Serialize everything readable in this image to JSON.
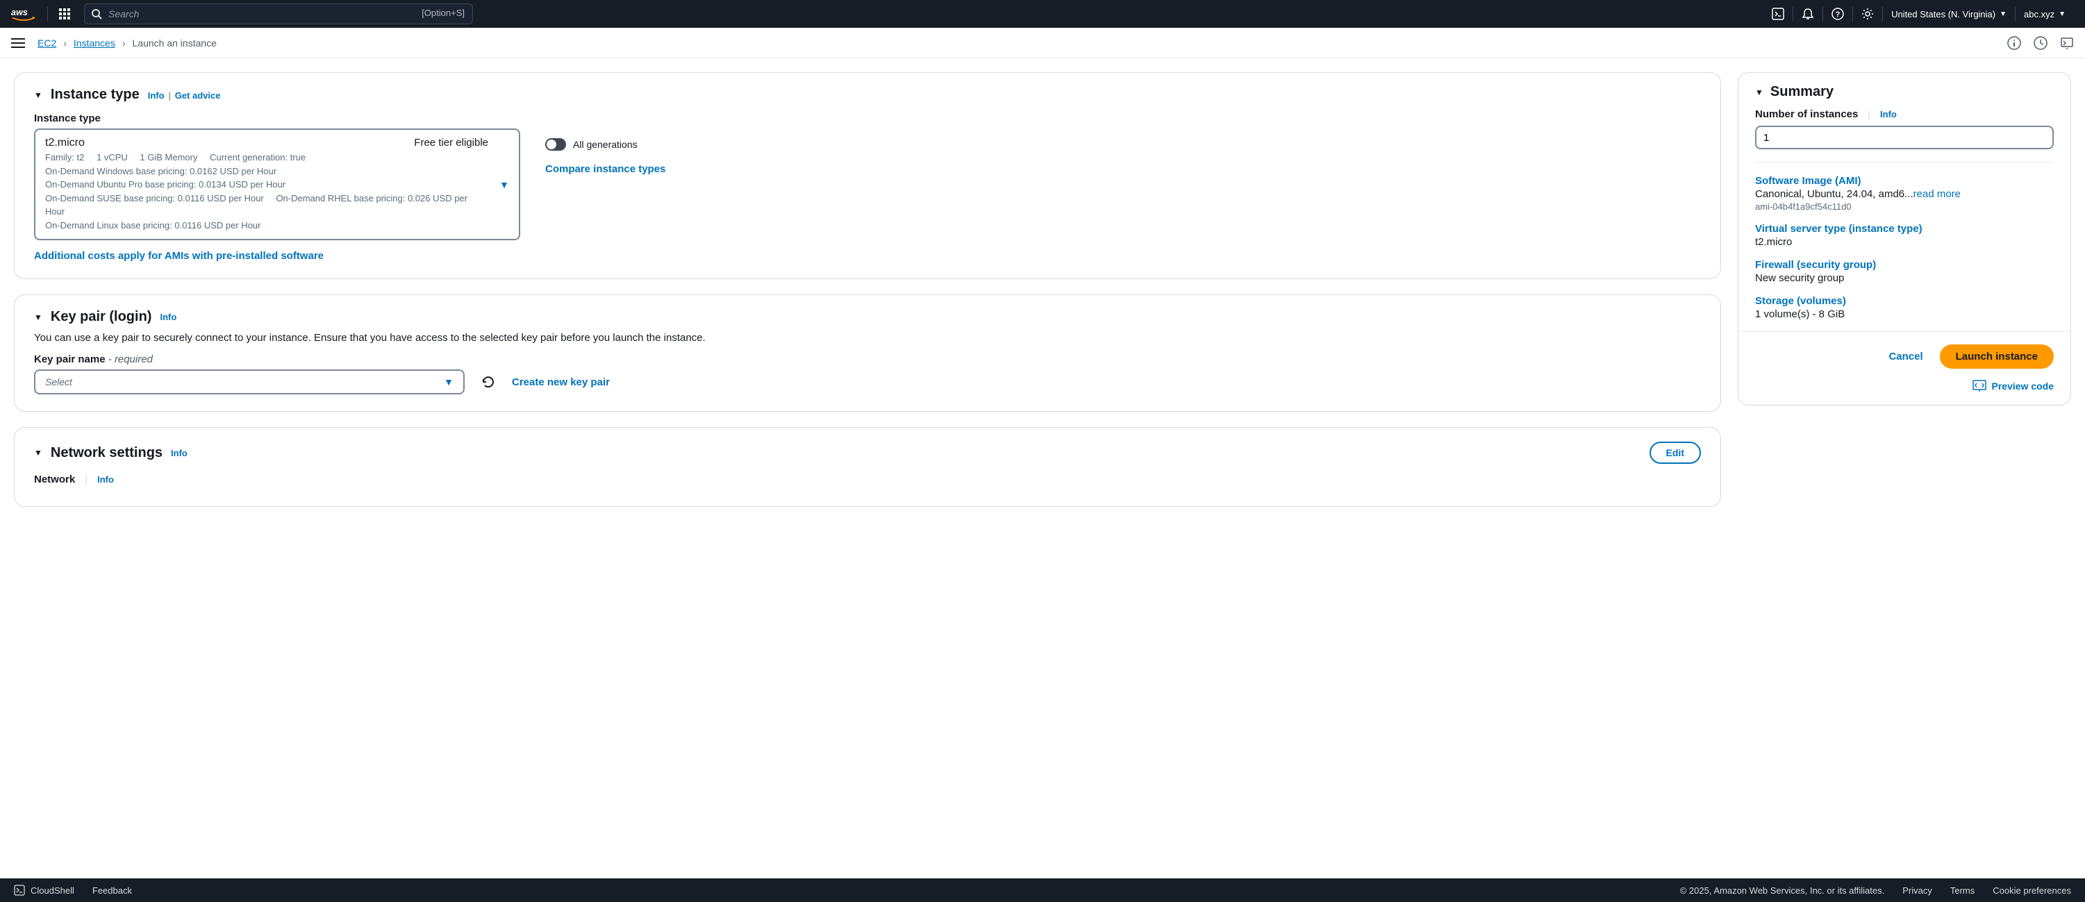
{
  "topnav": {
    "search_placeholder": "Search",
    "search_shortcut": "[Option+S]",
    "region": "United States (N. Virginia)",
    "account": "abc.xyz"
  },
  "breadcrumb": {
    "root": "EC2",
    "mid": "Instances",
    "current": "Launch an instance"
  },
  "instance_type_panel": {
    "title": "Instance type",
    "info": "Info",
    "advice": "Get advice",
    "field_label": "Instance type",
    "selected": {
      "name": "t2.micro",
      "free_tier": "Free tier eligible",
      "family": "Family: t2",
      "vcpu": "1 vCPU",
      "memory": "1 GiB Memory",
      "generation": "Current generation: true",
      "windows": "On-Demand Windows base pricing: 0.0162 USD per Hour",
      "ubuntu": "On-Demand Ubuntu Pro base pricing: 0.0134 USD per Hour",
      "suse": "On-Demand SUSE base pricing: 0.0116 USD per Hour",
      "rhel": "On-Demand RHEL base pricing: 0.026 USD per Hour",
      "linux": "On-Demand Linux base pricing: 0.0116 USD per Hour"
    },
    "all_generations": "All generations",
    "compare": "Compare instance types",
    "cost_note": "Additional costs apply for AMIs with pre-installed software"
  },
  "keypair_panel": {
    "title": "Key pair (login)",
    "info": "Info",
    "description": "You can use a key pair to securely connect to your instance. Ensure that you have access to the selected key pair before you launch the instance.",
    "field_label": "Key pair name",
    "required": " - required",
    "placeholder": "Select",
    "create": "Create new key pair"
  },
  "network_panel": {
    "title": "Network settings",
    "info": "Info",
    "edit": "Edit",
    "network_label": "Network",
    "network_info": "Info"
  },
  "summary": {
    "title": "Summary",
    "num_label": "Number of instances",
    "info": "Info",
    "num_value": "1",
    "ami_title": "Software Image (AMI)",
    "ami_value": "Canonical, Ubuntu, 24.04, amd6...",
    "read_more": "read more",
    "ami_id": "ami-04b4f1a9cf54c11d0",
    "type_title": "Virtual server type (instance type)",
    "type_value": "t2.micro",
    "firewall_title": "Firewall (security group)",
    "firewall_value": "New security group",
    "storage_title": "Storage (volumes)",
    "storage_value": "1 volume(s) - 8 GiB",
    "cancel": "Cancel",
    "launch": "Launch instance",
    "preview": "Preview code"
  },
  "footer": {
    "cloudshell": "CloudShell",
    "feedback": "Feedback",
    "copyright": "© 2025, Amazon Web Services, Inc. or its affiliates.",
    "privacy": "Privacy",
    "terms": "Terms",
    "cookies": "Cookie preferences"
  }
}
